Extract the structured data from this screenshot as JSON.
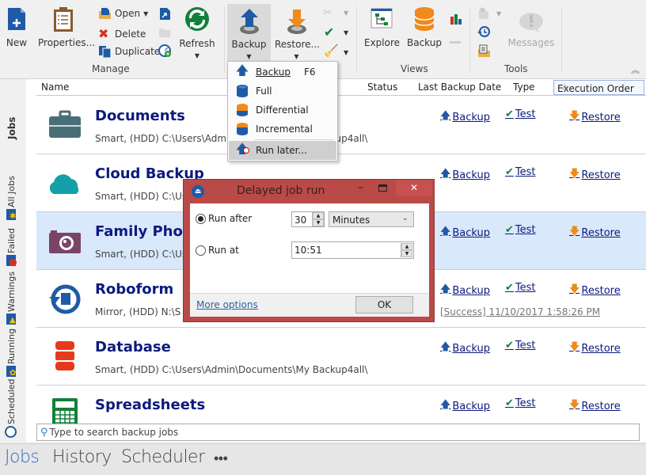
{
  "ribbon": {
    "manage": {
      "group_label": "Manage",
      "new_label": "New",
      "properties_label": "Properties...",
      "open_label": "Open",
      "delete_label": "Delete",
      "duplicate_label": "Duplicate",
      "refresh_label": "Refresh"
    },
    "backup_group": {
      "backup_label": "Backup",
      "restore_label": "Restore..."
    },
    "views": {
      "group_label": "Views",
      "explore_label": "Explore",
      "backup_label": "Backup"
    },
    "tools": {
      "group_label": "Tools",
      "messages_label": "Messages"
    }
  },
  "backup_menu": {
    "items": [
      {
        "label": "Backup",
        "shortcut": "F6",
        "icon": "backup-arrow-icon"
      },
      {
        "label": "Full",
        "icon": "full-db-icon"
      },
      {
        "label": "Differential",
        "icon": "differential-db-icon"
      },
      {
        "label": "Incremental",
        "icon": "incremental-db-icon"
      },
      {
        "label": "Run later...",
        "icon": "run-later-icon",
        "highlighted": true
      }
    ]
  },
  "sidebar": {
    "title": "Jobs",
    "filters": [
      "All Jobs",
      "Failed",
      "Warnings",
      "Running",
      "Scheduled"
    ]
  },
  "columns": [
    "Name",
    "Status",
    "Last Backup Date",
    "Type",
    "Execution Order"
  ],
  "actions": {
    "backup": "Backup",
    "test": "Test",
    "restore": "Restore"
  },
  "jobs": [
    {
      "name": "Documents",
      "detail": "Smart, (HDD) C:\\Users\\Admin\\Documents\\My Backup4all\\",
      "icon": "briefcase-icon",
      "status": ""
    },
    {
      "name": "Cloud Backup",
      "detail": "Smart, (HDD) C:\\Us",
      "icon": "cloud-icon",
      "status": ""
    },
    {
      "name": "Family Photos",
      "detail": "Smart, (HDD) C:\\Us",
      "icon": "camera-icon",
      "status": "",
      "selected": true
    },
    {
      "name": "Roboform",
      "detail": "Mirror, (HDD) N:\\S",
      "icon": "restore-file-icon",
      "status": "[Success] 11/10/2017 1:58:26 PM"
    },
    {
      "name": "Database",
      "detail": "Smart, (HDD) C:\\Users\\Admin\\Documents\\My Backup4all\\",
      "icon": "database-icon",
      "status": ""
    },
    {
      "name": "Spreadsheets",
      "detail": "",
      "icon": "calculator-icon",
      "status": ""
    }
  ],
  "search": {
    "placeholder": "Type to search backup jobs"
  },
  "bottom_tabs": [
    "Jobs",
    "History",
    "Scheduler",
    "•••"
  ],
  "dialog": {
    "title": "Delayed job run",
    "run_after_label": "Run after",
    "run_after_value": "30",
    "unit_value": "Minutes",
    "run_at_label": "Run at",
    "run_at_value": "10:51",
    "selected_option": "Run after",
    "more_options_label": "More options",
    "ok_label": "OK"
  }
}
